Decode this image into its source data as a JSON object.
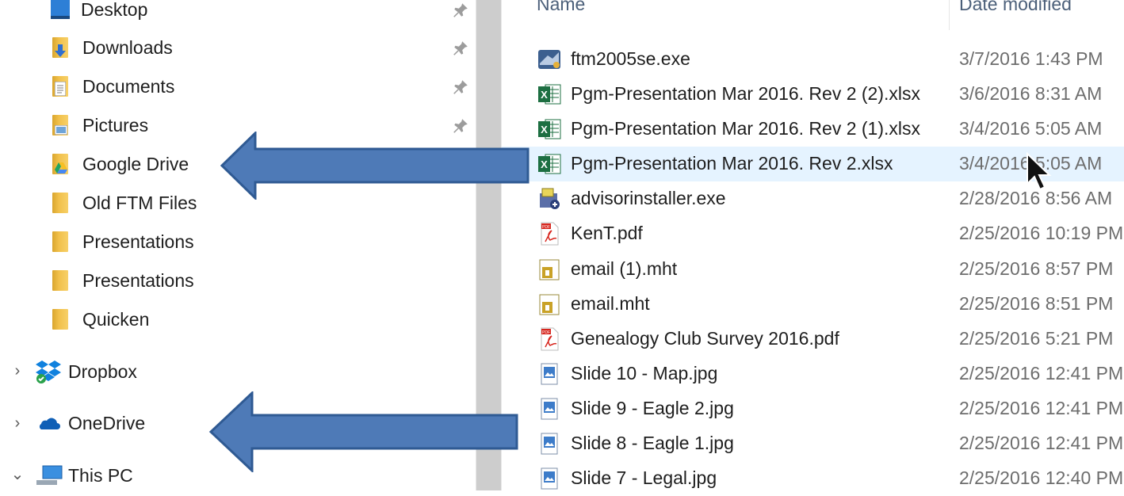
{
  "nav": {
    "items": [
      {
        "label": "Desktop",
        "icon": "desktop-icon",
        "pinned": true
      },
      {
        "label": "Downloads",
        "icon": "downloads-folder-icon",
        "pinned": true
      },
      {
        "label": "Documents",
        "icon": "documents-folder-icon",
        "pinned": true
      },
      {
        "label": "Pictures",
        "icon": "pictures-folder-icon",
        "pinned": true
      },
      {
        "label": "Google Drive",
        "icon": "google-drive-folder-icon",
        "pinned": false
      },
      {
        "label": "Old FTM Files",
        "icon": "folder-icon",
        "pinned": false
      },
      {
        "label": "Presentations",
        "icon": "folder-icon",
        "pinned": false
      },
      {
        "label": "Presentations",
        "icon": "folder-icon",
        "pinned": false
      },
      {
        "label": "Quicken",
        "icon": "folder-icon",
        "pinned": false
      }
    ],
    "roots": [
      {
        "label": "Dropbox",
        "icon": "dropbox-icon",
        "expander": "›",
        "expanded": false
      },
      {
        "label": "OneDrive",
        "icon": "onedrive-cloud-icon",
        "expander": "›",
        "expanded": false
      },
      {
        "label": "This PC",
        "icon": "this-pc-icon",
        "expander": "⌄",
        "expanded": true
      }
    ]
  },
  "columns": {
    "name": "Name",
    "date_modified": "Date modified"
  },
  "files": [
    {
      "name": "ftm2005se.exe",
      "date": "3/7/2016 1:43 PM",
      "icon": "ftm-app-icon"
    },
    {
      "name": "Pgm-Presentation Mar 2016. Rev 2 (2).xlsx",
      "date": "3/6/2016 8:31 AM",
      "icon": "excel-icon"
    },
    {
      "name": "Pgm-Presentation Mar 2016. Rev 2 (1).xlsx",
      "date": "3/4/2016 5:05 AM",
      "icon": "excel-icon"
    },
    {
      "name": "Pgm-Presentation Mar 2016. Rev 2.xlsx",
      "date": "3/4/2016 5:05 AM",
      "icon": "excel-icon",
      "selected": true
    },
    {
      "name": "advisorinstaller.exe",
      "date": "2/28/2016 8:56 AM",
      "icon": "installer-icon"
    },
    {
      "name": "KenT.pdf",
      "date": "2/25/2016 10:19 PM",
      "icon": "pdf-icon"
    },
    {
      "name": "email (1).mht",
      "date": "2/25/2016 8:57 PM",
      "icon": "mht-icon"
    },
    {
      "name": "email.mht",
      "date": "2/25/2016 8:51 PM",
      "icon": "mht-icon"
    },
    {
      "name": "Genealogy Club Survey 2016.pdf",
      "date": "2/25/2016 5:21 PM",
      "icon": "pdf-icon"
    },
    {
      "name": "Slide 10 - Map.jpg",
      "date": "2/25/2016 12:41 PM",
      "icon": "image-icon"
    },
    {
      "name": "Slide 9 - Eagle 2.jpg",
      "date": "2/25/2016 12:41 PM",
      "icon": "image-icon"
    },
    {
      "name": "Slide 8 - Eagle 1.jpg",
      "date": "2/25/2016 12:41 PM",
      "icon": "image-icon"
    },
    {
      "name": "Slide 7 - Legal.jpg",
      "date": "2/25/2016 12:40 PM",
      "icon": "image-icon"
    }
  ],
  "colors": {
    "annotation_arrow": "#4e7ab7",
    "selection": "#e5f3ff",
    "folder": "#f1c04a"
  }
}
